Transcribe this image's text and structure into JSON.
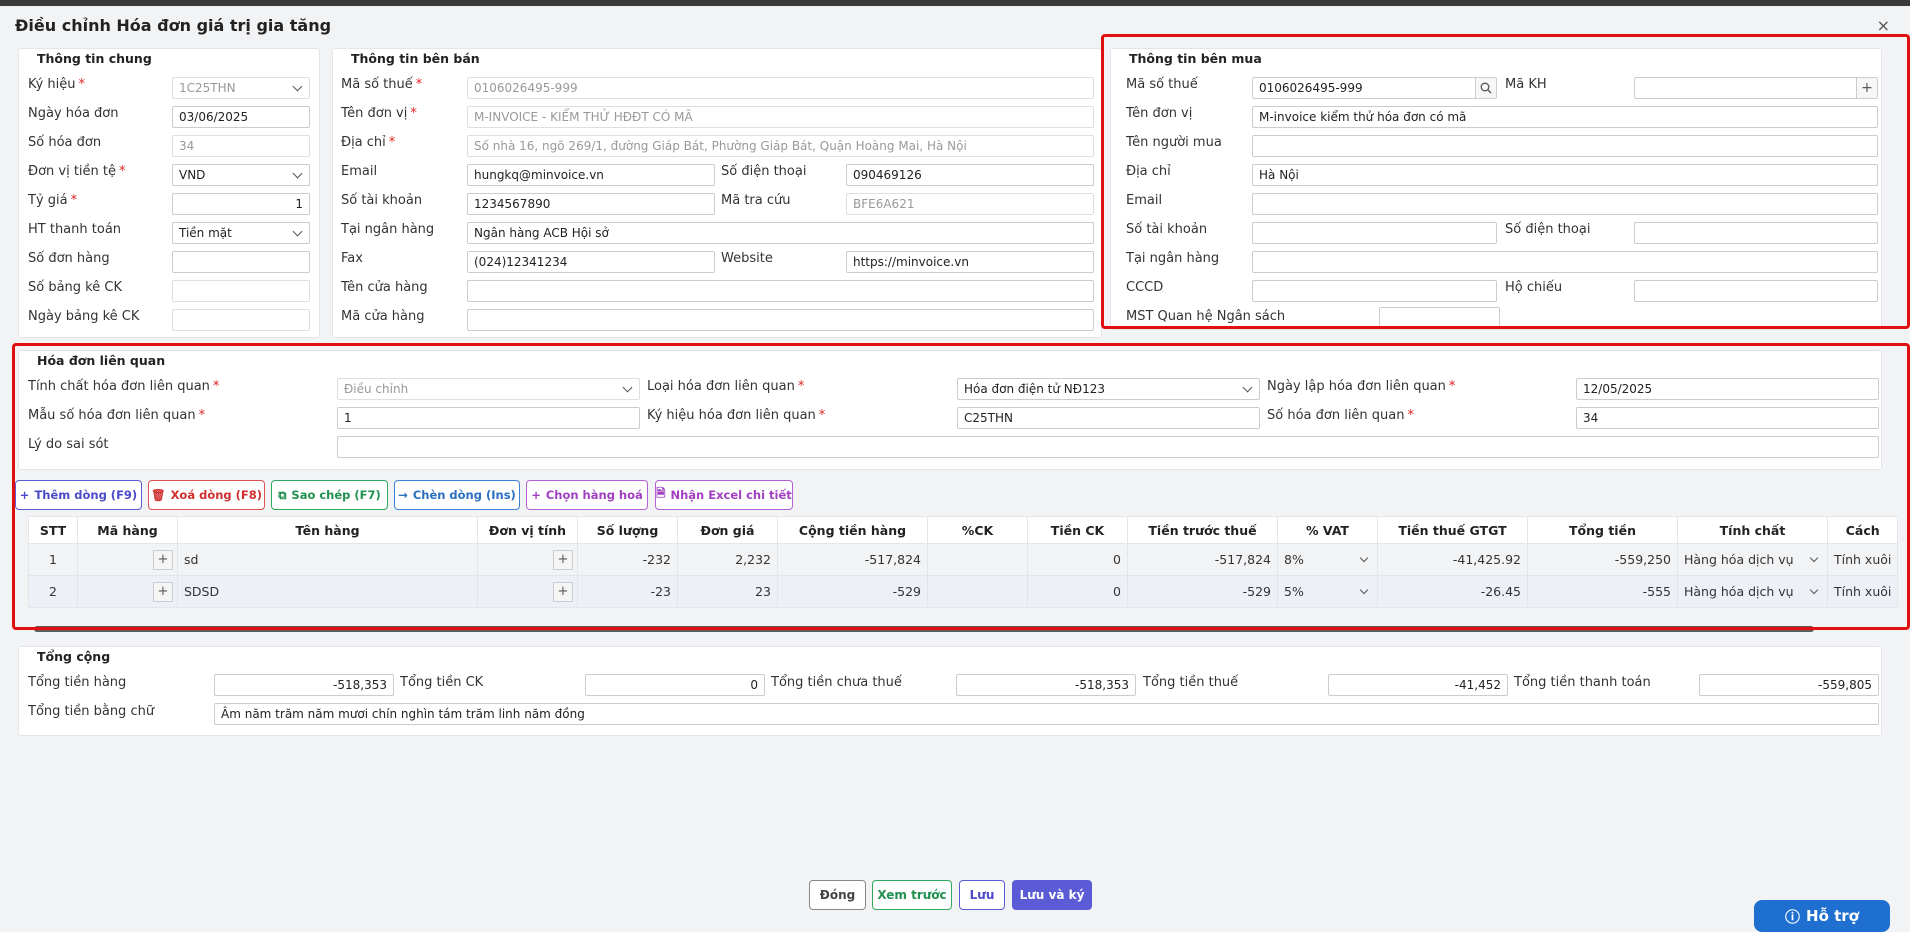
{
  "dialog": {
    "title": "Điều chỉnh Hóa đơn giá trị gia tăng",
    "close": "×"
  },
  "general": {
    "title": "Thông tin chung",
    "symbol_label": "Ký hiệu",
    "symbol": "1C25THN",
    "date_label": "Ngày hóa đơn",
    "date": "03/06/2025",
    "number_label": "Số hóa đơn",
    "number": "34",
    "currency_label": "Đơn vị tiền tệ",
    "currency": "VND",
    "rate_label": "Tỷ giá",
    "rate": "1",
    "payment_label": "HT thanh toán",
    "payment": "Tiền mặt",
    "order_label": "Số đơn hàng",
    "order": "",
    "list_label": "Số bảng kê CK",
    "list": "",
    "list_date_label": "Ngày bảng kê CK",
    "list_date": ""
  },
  "seller": {
    "title": "Thông tin bên bán",
    "tax_label": "Mã số thuế",
    "tax": "0106026495-999",
    "name_label": "Tên đơn vị",
    "name": "M-INVOICE - KIỂM THỬ HĐĐT CÓ MÃ",
    "address_label": "Địa chỉ",
    "address": "Số nhà 16, ngõ 269/1, đường Giáp Bát, Phường Giáp Bát, Quận Hoàng Mai, Hà Nội",
    "email_label": "Email",
    "email": "hungkq@minvoice.vn",
    "phone_label": "Số điện thoại",
    "phone": "090469126",
    "account_label": "Số tài khoản",
    "account": "1234567890",
    "lookup_label": "Mã tra cứu",
    "lookup": "BFE6A621",
    "bank_label": "Tại ngân hàng",
    "bank": "Ngân hàng ACB Hội sở",
    "fax_label": "Fax",
    "fax": "(024)12341234",
    "website_label": "Website",
    "website": "https://minvoice.vn",
    "store_name_label": "Tên cửa hàng",
    "store_name": "",
    "store_code_label": "Mã cửa hàng",
    "store_code": ""
  },
  "buyer": {
    "title": "Thông tin bên mua",
    "tax_label": "Mã số thuế",
    "tax": "0106026495-999",
    "customer_code_label": "Mã KH",
    "customer_code": "",
    "name_label": "Tên đơn vị",
    "name": "M-invoice kiểm thử hóa đơn có mã",
    "buyer_name_label": "Tên người mua",
    "buyer_name": "",
    "address_label": "Địa chỉ",
    "address": "Hà Nội",
    "email_label": "Email",
    "email": "",
    "account_label": "Số tài khoản",
    "account": "",
    "phone_label": "Số điện thoại",
    "phone": "",
    "bank_label": "Tại ngân hàng",
    "bank": "",
    "id_label": "CCCD",
    "id": "",
    "passport_label": "Hộ chiếu",
    "passport": "",
    "budget_label": "MST Quan hệ Ngân sách",
    "budget": ""
  },
  "related": {
    "title": "Hóa đơn liên quan",
    "nature_label": "Tính chất hóa đơn liên quan",
    "nature": "Điều chỉnh",
    "type_label": "Loại hóa đơn liên quan",
    "type": "Hóa đơn điện tử NĐ123",
    "date_label": "Ngày lập hóa đơn liên quan",
    "date": "12/05/2025",
    "template_label": "Mẫu số hóa đơn liên quan",
    "template": "1",
    "symbol_label": "Ký hiệu hóa đơn liên quan",
    "symbol": "C25THN",
    "number_label": "Số hóa đơn liên quan",
    "number": "34",
    "reason_label": "Lý do sai sót",
    "reason": ""
  },
  "toolbar": {
    "add": "Thêm dòng (F9)",
    "delete": "Xoá dòng (F8)",
    "copy": "Sao chép (F7)",
    "insert": "Chèn dòng (Ins)",
    "choose": "Chọn hàng hoá",
    "excel": "Nhận Excel chi tiết"
  },
  "table": {
    "headers": [
      "STT",
      "Mã hàng",
      "Tên hàng",
      "Đơn vị tính",
      "Số lượng",
      "Đơn giá",
      "Cộng tiền hàng",
      "%CK",
      "Tiền CK",
      "Tiền trước thuế",
      "% VAT",
      "Tiền thuế GTGT",
      "Tổng tiền",
      "Tính chất",
      "Cách"
    ],
    "rows": [
      [
        "1",
        "",
        "sd",
        "",
        "-232",
        "2,232",
        "-517,824",
        "",
        "0",
        "-517,824",
        "8%",
        "-41,425.92",
        "-559,250",
        "Hàng hóa dịch vụ",
        "Tính xuôi"
      ],
      [
        "2",
        "",
        "SDSD",
        "",
        "-23",
        "23",
        "-529",
        "",
        "0",
        "-529",
        "5%",
        "-26.45",
        "-555",
        "Hàng hóa dịch vụ",
        "Tính xuôi"
      ]
    ]
  },
  "totals": {
    "title": "Tổng cộng",
    "goods_label": "Tổng tiền hàng",
    "goods": "-518,353",
    "discount_label": "Tổng tiền CK",
    "discount": "0",
    "pretax_label": "Tổng tiền chưa thuế",
    "pretax": "-518,353",
    "tax_label": "Tổng tiền thuế",
    "tax": "-41,452",
    "payment_label": "Tổng tiền thanh toán",
    "payment": "-559,805",
    "words_label": "Tổng tiền bằng chữ",
    "words": "Âm năm trăm năm mươi chín nghìn tám trăm linh năm đồng"
  },
  "footer": {
    "close": "Đóng",
    "preview": "Xem trước",
    "save": "Lưu",
    "save_sign": "Lưu và ký"
  },
  "help": {
    "label": "Hỗ trợ"
  },
  "colors": {
    "accent": "#5b5bd6",
    "highlight": "#e01010",
    "help": "#1f6fd1"
  }
}
